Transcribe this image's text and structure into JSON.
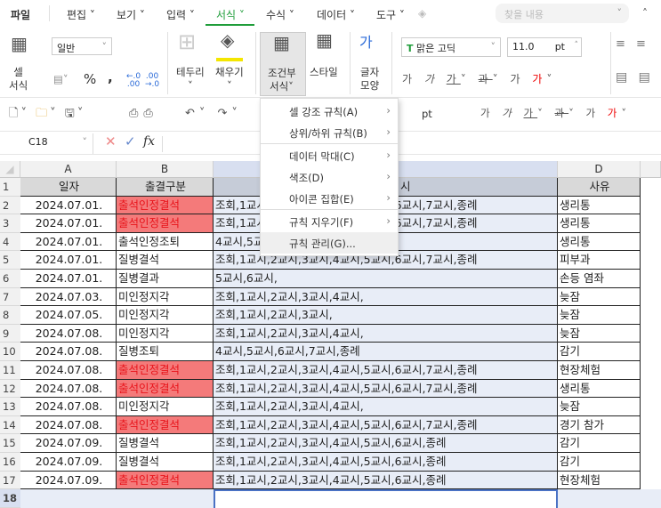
{
  "tabs": {
    "items": [
      "파일",
      "편집",
      "보기",
      "입력",
      "서식",
      "수식",
      "데이터",
      "도구"
    ],
    "active": "서식"
  },
  "search": {
    "placeholder": "찾을 내용"
  },
  "ribbon": {
    "cell_format": "셀\n서식",
    "number_format": "일반",
    "border": "테두리",
    "fill": "채우기",
    "conditional": "조건부",
    "conditional2": "서식",
    "style": "스타일",
    "font_shape": "글자\n모양",
    "font_name": "맑은 고딕",
    "font_size": "11.0",
    "pt": "pt",
    "percent": "%",
    "comma": ","
  },
  "quickbar": {
    "pt": "pt"
  },
  "formula_bar": {
    "cell_ref": "C18",
    "fx": "fx"
  },
  "columns": [
    "A",
    "B",
    "C",
    "D"
  ],
  "header_row": {
    "A": "일자",
    "B": "출결구분",
    "C": "시",
    "D": "사유"
  },
  "rows": [
    {
      "n": "2",
      "date": "2024.07.01.",
      "type": "출석인정결석",
      "hl": true,
      "periods": "조회,1교시,2교시,3교시,4교시,5교시,6교시,7교시,종례",
      "reason": "생리통"
    },
    {
      "n": "3",
      "date": "2024.07.01.",
      "type": "출석인정결석",
      "hl": true,
      "periods": "조회,1교시,2교시,3교시,4교시,5교시,6교시,7교시,종례",
      "reason": "생리통"
    },
    {
      "n": "4",
      "date": "2024.07.01.",
      "type": "출석인정조퇴",
      "hl": false,
      "periods": "4교시,5교시,",
      "reason": "생리통"
    },
    {
      "n": "5",
      "date": "2024.07.01.",
      "type": "질병결석",
      "hl": false,
      "periods": "조회,1교시,2교시,3교시,4교시,5교시,6교시,7교시,종례",
      "reason": "피부과"
    },
    {
      "n": "6",
      "date": "2024.07.01.",
      "type": "질병결과",
      "hl": false,
      "periods": "5교시,6교시,",
      "reason": "손등 염좌"
    },
    {
      "n": "7",
      "date": "2024.07.03.",
      "type": "미인정지각",
      "hl": false,
      "periods": "조회,1교시,2교시,3교시,4교시,",
      "reason": "늦잠"
    },
    {
      "n": "8",
      "date": "2024.07.05.",
      "type": "미인정지각",
      "hl": false,
      "periods": "조회,1교시,2교시,3교시,",
      "reason": "늦잠"
    },
    {
      "n": "9",
      "date": "2024.07.08.",
      "type": "미인정지각",
      "hl": false,
      "periods": "조회,1교시,2교시,3교시,4교시,",
      "reason": "늦잠"
    },
    {
      "n": "10",
      "date": "2024.07.08.",
      "type": "질병조퇴",
      "hl": false,
      "periods": "4교시,5교시,6교시,7교시,종례",
      "reason": "감기"
    },
    {
      "n": "11",
      "date": "2024.07.08.",
      "type": "출석인정결석",
      "hl": true,
      "periods": "조회,1교시,2교시,3교시,4교시,5교시,6교시,7교시,종례",
      "reason": "현장체험"
    },
    {
      "n": "12",
      "date": "2024.07.08.",
      "type": "출석인정결석",
      "hl": true,
      "periods": "조회,1교시,2교시,3교시,4교시,5교시,6교시,7교시,종례",
      "reason": "생리통"
    },
    {
      "n": "13",
      "date": "2024.07.08.",
      "type": "미인정지각",
      "hl": false,
      "periods": "조회,1교시,2교시,3교시,4교시,",
      "reason": "늦잠"
    },
    {
      "n": "14",
      "date": "2024.07.08.",
      "type": "출석인정결석",
      "hl": true,
      "periods": "조회,1교시,2교시,3교시,4교시,5교시,6교시,7교시,종례",
      "reason": "경기 참가"
    },
    {
      "n": "15",
      "date": "2024.07.09.",
      "type": "질병결석",
      "hl": false,
      "periods": "조회,1교시,2교시,3교시,4교시,5교시,6교시,종례",
      "reason": "감기"
    },
    {
      "n": "16",
      "date": "2024.07.09.",
      "type": "질병결석",
      "hl": false,
      "periods": "조회,1교시,2교시,3교시,4교시,5교시,6교시,종례",
      "reason": "감기"
    },
    {
      "n": "17",
      "date": "2024.07.09.",
      "type": "출석인정결석",
      "hl": true,
      "periods": "조회,1교시,2교시,3교시,4교시,5교시,6교시,종례",
      "reason": "현장체험"
    },
    {
      "n": "18",
      "date": "",
      "type": "",
      "hl": false,
      "periods": "",
      "reason": ""
    }
  ],
  "menu": {
    "items": [
      {
        "label": "셀 강조 규칙(A)",
        "sub": true
      },
      {
        "label": "상위/하위 규칙(B)",
        "sub": true
      },
      {
        "label": "데이터 막대(C)",
        "sub": true
      },
      {
        "label": "색조(D)",
        "sub": true
      },
      {
        "label": "아이콘 집합(E)",
        "sub": true
      },
      {
        "label": "규칙 지우기(F)",
        "sub": true
      },
      {
        "label": "규칙 관리(G)...",
        "sub": false
      }
    ]
  },
  "colors": {
    "accent": "#1f9d3a",
    "highlight_fill": "#f47a7a",
    "highlight_text": "#e8141b",
    "selected_col": "#e8edf7"
  }
}
